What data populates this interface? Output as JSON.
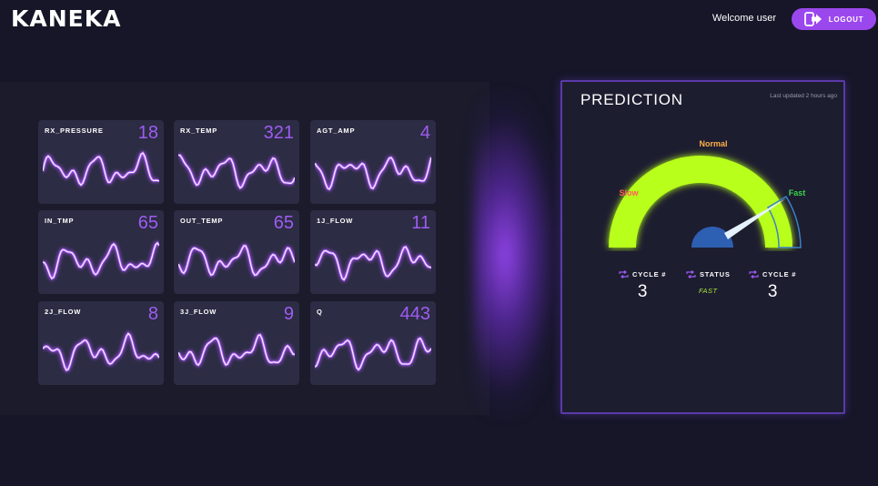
{
  "header": {
    "logo": "KANEKA",
    "welcome": "Welcome user",
    "logout_label": "LOGOUT"
  },
  "colors": {
    "accent": "#9b47ee",
    "value": "#9e5cf2",
    "gauge_fill": "#b8ff1a",
    "gauge_base": "#2d5fb2",
    "slow": "#ff5a5a",
    "normal": "#ffb04a",
    "fast": "#39d44a"
  },
  "sensors": [
    {
      "label": "RX_PRESSURE",
      "value": "18"
    },
    {
      "label": "RX_TEMP",
      "value": "321"
    },
    {
      "label": "AGT_AMP",
      "value": "4"
    },
    {
      "label": "IN_TMP",
      "value": "65"
    },
    {
      "label": "OUT_TEMP",
      "value": "65"
    },
    {
      "label": "1J_FLOW",
      "value": "11"
    },
    {
      "label": "2J_FLOW",
      "value": "8"
    },
    {
      "label": "3J_FLOW",
      "value": "9"
    },
    {
      "label": "Q",
      "value": "443"
    }
  ],
  "prediction": {
    "title": "PREDICTION",
    "updated": "Last updated 2 hours ago",
    "gauge": {
      "slow": "Slow",
      "normal": "Normal",
      "fast": "Fast"
    },
    "stats": [
      {
        "label": "CYCLE #",
        "value": "3",
        "icon": "cycle-icon"
      },
      {
        "label": "STATUS",
        "value": "FAST",
        "icon": "cycle-icon"
      },
      {
        "label": "CYCLE #",
        "value": "3",
        "icon": "cycle-icon"
      }
    ]
  }
}
